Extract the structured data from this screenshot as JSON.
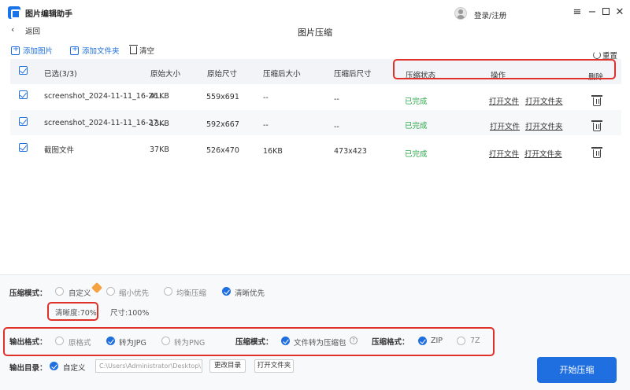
{
  "app": {
    "title": "图片编辑助手",
    "login": "登录/注册"
  },
  "nav": {
    "back": "返回",
    "page_title": "图片压缩"
  },
  "toolbar": {
    "add_image": "添加图片",
    "add_folder": "添加文件夹",
    "clear": "清空",
    "reset": "重置"
  },
  "table": {
    "headers": [
      "已选(3/3)",
      "原始大小",
      "原始尺寸",
      "压缩后大小",
      "压缩后尺寸",
      "压缩状态",
      "操作",
      "删除"
    ],
    "rows": [
      {
        "name": "screenshot_2024-11-11_16-26...",
        "orig_size": "41KB",
        "orig_dim": "559x691",
        "new_size": "--",
        "new_dim": "--",
        "status": "已完成",
        "open_file": "打开文件",
        "open_folder": "打开文件夹"
      },
      {
        "name": "screenshot_2024-11-11_16-27...",
        "orig_size": "13KB",
        "orig_dim": "592x667",
        "new_size": "--",
        "new_dim": "--",
        "status": "已完成",
        "open_file": "打开文件",
        "open_folder": "打开文件夹"
      },
      {
        "name": "截图文件",
        "orig_size": "37KB",
        "orig_dim": "526x470",
        "new_size": "16KB",
        "new_dim": "473x423",
        "status": "已完成",
        "open_file": "打开文件",
        "open_folder": "打开文件夹"
      }
    ]
  },
  "settings": {
    "mode_label": "压缩模式：",
    "modes": [
      "自定义",
      "缩小优先",
      "均衡压缩",
      "清晰优先"
    ],
    "selected_mode": "清晰优先",
    "clarity": "清晰度:70%",
    "size": "尺寸:100%",
    "format_label": "输出格式：",
    "formats": [
      "原格式",
      "转为JPG",
      "转为PNG"
    ],
    "selected_format": "转为JPG",
    "pack_mode_label": "压缩模式：",
    "pack_option": "文件转为压缩包",
    "archive_label": "压缩格式：",
    "archive_formats": [
      "ZIP",
      "7Z"
    ],
    "selected_archive": "ZIP",
    "outdir_label": "输出目录：",
    "outdir_custom": "自定义",
    "outdir_path": "C:\\Users\\Administrator\\Desktop\\ ",
    "change_dir": "更改目录",
    "open_folder": "打开文件夹",
    "start": "开始压缩"
  },
  "colors": {
    "accent": "#1f6fe0",
    "done": "#2aa84a",
    "highlight": "#e0302a"
  }
}
